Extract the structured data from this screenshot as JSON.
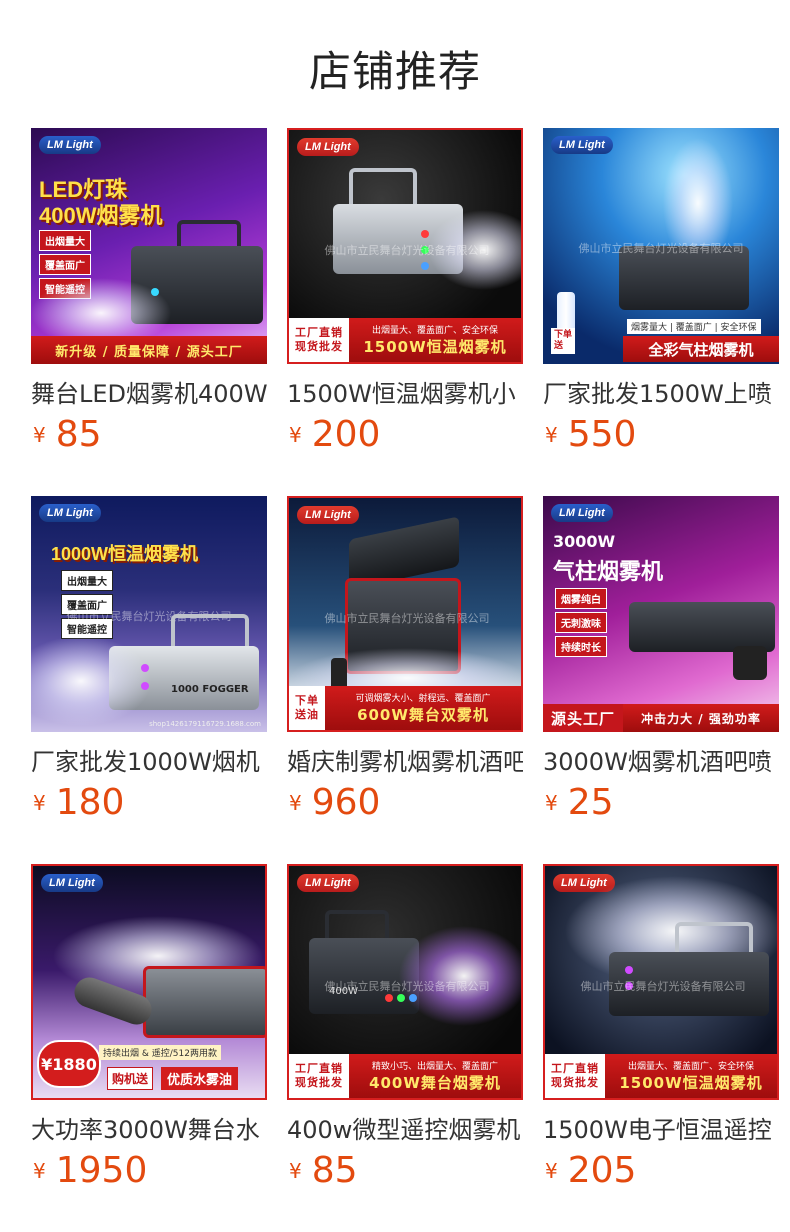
{
  "page": {
    "title": "店铺推荐"
  },
  "currency": "¥",
  "products": [
    {
      "name": "舞台LED烟雾机400W",
      "price": "85",
      "img": {
        "logo": "LM Light",
        "headline1": "LED灯珠",
        "headline2": "400W烟雾机",
        "tags": [
          "出烟量大",
          "覆盖面广",
          "智能遥控"
        ],
        "strip": "新升级 / 质量保障 / 源头工厂"
      }
    },
    {
      "name": "1500W恒温烟雾机小",
      "price": "200",
      "img": {
        "logo": "LM Light",
        "watermark": "佛山市立民舞台灯光设备有限公司",
        "left1": "工厂直销",
        "left2": "现货批发",
        "sub": "出烟量大、覆盖面广、安全环保",
        "main": "1500W恒温烟雾机"
      }
    },
    {
      "name": "厂家批发1500W上喷",
      "price": "550",
      "img": {
        "logo": "LM Light",
        "watermark": "佛山市立民舞台灯光设备有限公司",
        "gift1": "下单",
        "gift2": "送",
        "sub": "烟雾量大 | 覆盖面广 | 安全环保",
        "main": "全彩气柱烟雾机"
      }
    },
    {
      "name": "厂家批发1000W烟机",
      "price": "180",
      "img": {
        "logo": "LM Light",
        "headline": "1000W恒温烟雾机",
        "tags": [
          "出烟量大",
          "覆盖面广",
          "智能遥控"
        ],
        "watermark": "佛山市立民舞台灯光设备有限公司",
        "model": "1000 FOGGER",
        "footer": "shop1426179116729.1688.com"
      }
    },
    {
      "name": "婚庆制雾机烟雾机酒吧",
      "price": "960",
      "img": {
        "logo": "LM Light",
        "watermark": "佛山市立民舞台灯光设备有限公司",
        "left1": "下单",
        "left2": "送油",
        "sub": "可调烟雾大小、射程远、覆盖面广",
        "main": "600W舞台双雾机"
      }
    },
    {
      "name": "3000W烟雾机酒吧喷",
      "price": "25",
      "img": {
        "logo": "LM Light",
        "headline1": "3000W",
        "headline2": "气柱烟雾机",
        "tags": [
          "烟雾纯白",
          "无刺激味",
          "持续时长"
        ],
        "strip_left": "源头工厂",
        "strip_right": "冲击力大 / 强劲功率"
      }
    },
    {
      "name": "大功率3000W舞台水",
      "price": "1950",
      "img": {
        "logo": "LM Light",
        "badge": "¥1880",
        "sub": "持续出烟 & 遥控/512两用款",
        "btn": "购机送",
        "main": "优质水雾油"
      }
    },
    {
      "name": "400w微型遥控烟雾机",
      "price": "85",
      "img": {
        "logo": "LM Light",
        "watermark": "佛山市立民舞台灯光设备有限公司",
        "left1": "工厂直销",
        "left2": "现货批发",
        "sub": "精致小巧、出烟量大、覆盖面广",
        "main": "400W舞台烟雾机",
        "model": "400W"
      }
    },
    {
      "name": "1500W电子恒温遥控",
      "price": "205",
      "img": {
        "logo": "LM Light",
        "watermark": "佛山市立民舞台灯光设备有限公司",
        "left1": "工厂直销",
        "left2": "现货批发",
        "sub": "出烟量大、覆盖面广、安全环保",
        "main": "1500W恒温烟雾机"
      }
    }
  ]
}
